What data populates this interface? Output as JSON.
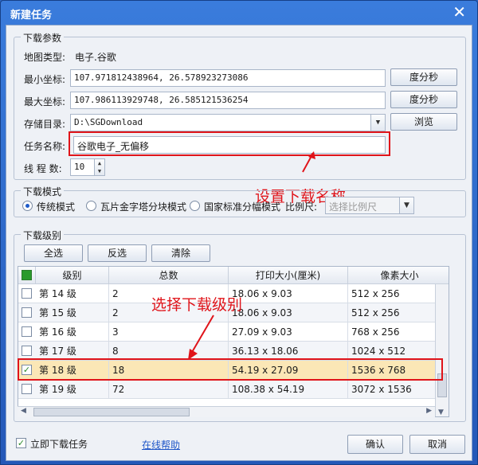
{
  "window": {
    "title": "新建任务",
    "close_glyph": "✕"
  },
  "download_params": {
    "legend": "下载参数",
    "map_type_label": "地图类型:",
    "map_type_value": "电子.谷歌",
    "min_coord_label": "最小坐标:",
    "min_coord_value": "107.971812438964, 26.578923273086",
    "max_coord_label": "最大坐标:",
    "max_coord_value": "107.986113929748, 26.585121536254",
    "dms_button": "度分秒",
    "storage_label": "存储目录:",
    "storage_value": "D:\\SGDownload",
    "browse_button": "浏览",
    "task_name_label": "任务名称:",
    "task_name_value": "谷歌电子_无偏移",
    "threads_label": "线 程 数:",
    "threads_value": "10"
  },
  "download_mode": {
    "legend": "下载模式",
    "options": [
      "传统模式",
      "瓦片金字塔分块模式",
      "国家标准分幅模式"
    ],
    "scale_label": "比例尺:",
    "scale_placeholder": "选择比例尺"
  },
  "levels": {
    "legend": "下载级别",
    "select_all": "全选",
    "invert": "反选",
    "clear": "清除",
    "columns": [
      "级别",
      "总数",
      "打印大小(厘米)",
      "像素大小"
    ],
    "rows": [
      {
        "level": "第 14 级",
        "count": "2",
        "print": "18.06 x 9.03",
        "pixels": "512 x 256",
        "checked": false
      },
      {
        "level": "第 15 级",
        "count": "2",
        "print": "18.06 x 9.03",
        "pixels": "512 x 256",
        "checked": false
      },
      {
        "level": "第 16 级",
        "count": "3",
        "print": "27.09 x 9.03",
        "pixels": "768 x 256",
        "checked": false
      },
      {
        "level": "第 17 级",
        "count": "8",
        "print": "36.13 x 18.06",
        "pixels": "1024 x 512",
        "checked": false
      },
      {
        "level": "第 18 级",
        "count": "18",
        "print": "54.19 x 27.09",
        "pixels": "1536 x 768",
        "checked": true
      },
      {
        "level": "第 19 级",
        "count": "72",
        "print": "108.38 x 54.19",
        "pixels": "3072 x 1536",
        "checked": false
      }
    ]
  },
  "annotations": {
    "set_name": "设置下载名称",
    "select_level": "选择下载级别"
  },
  "footer": {
    "download_now": "立即下载任务",
    "help_link": "在线帮助",
    "ok": "确认",
    "cancel": "取消"
  },
  "colors": {
    "annotation": "#e0141a",
    "title_bar": "#2b67c6",
    "selected_row": "#fbe7b6"
  }
}
